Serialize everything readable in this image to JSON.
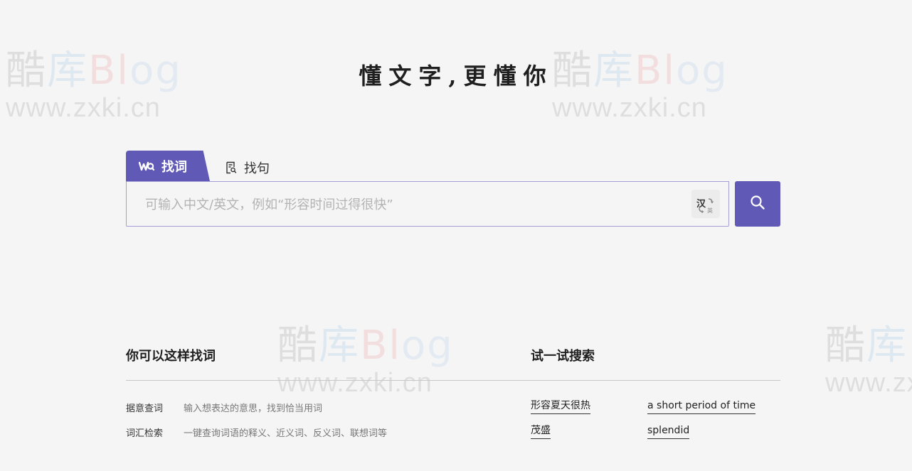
{
  "watermark": {
    "top_c1": "酷",
    "top_c2": "库",
    "top_c3": "Bl",
    "top_c4": "og",
    "url": "www.zxki.cn"
  },
  "slogan": "懂文字,更懂你",
  "tabs": [
    {
      "label": "找词",
      "icon": "wq-logo-icon",
      "active": true
    },
    {
      "label": "找句",
      "icon": "sentence-search-icon",
      "active": false
    }
  ],
  "search": {
    "placeholder": "可输入中文/英文，例如“形容时间过得很快”",
    "value": "",
    "lang_toggle_main": "汉",
    "lang_toggle_sub": "英"
  },
  "tips": {
    "title": "你可以这样找词",
    "items": [
      {
        "label": "据意查词",
        "desc": "输入想表达的意思，找到恰当用词"
      },
      {
        "label": "词汇检索",
        "desc": "一键查询词语的释义、近义词、反义词、联想词等"
      }
    ]
  },
  "try_search": {
    "title": "试一试搜索",
    "items": [
      "形容夏天很热",
      "a short period of time",
      "茂盛",
      "splendid"
    ]
  },
  "colors": {
    "accent": "#6059b6",
    "border": "#a39fd6",
    "background": "#f5f5f5"
  }
}
